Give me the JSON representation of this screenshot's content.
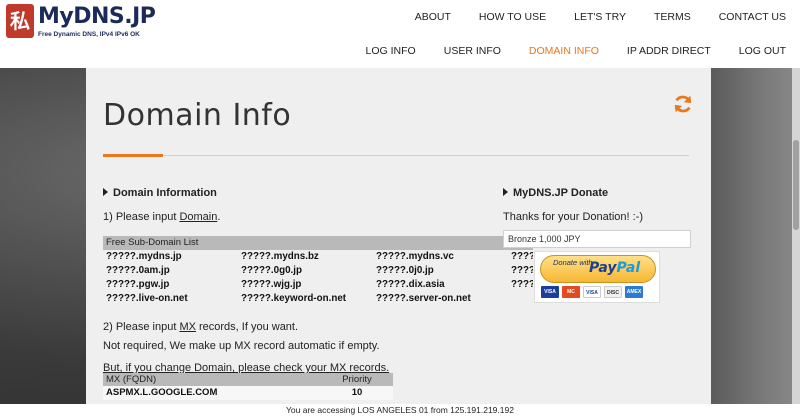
{
  "brand": {
    "logo_glyph": "私",
    "name": "MyDNS.JP",
    "tagline": "Free Dynamic DNS, IPv4 IPv6 OK"
  },
  "nav": {
    "row1": [
      "ABOUT",
      "HOW TO USE",
      "LET'S TRY",
      "TERMS",
      "CONTACT US"
    ],
    "row2": [
      "LOG INFO",
      "USER INFO",
      "DOMAIN INFO",
      "IP ADDR DIRECT",
      "LOG OUT"
    ],
    "active": "DOMAIN INFO",
    "accent_color": "#e8771d"
  },
  "page": {
    "title": "Domain Info",
    "refresh_icon": "refresh-icon"
  },
  "domain_info": {
    "heading": "Domain Information",
    "step1_prefix": "1) Please input ",
    "step1_link": "Domain",
    "step1_suffix": ".",
    "table_title": "Free Sub-Domain List",
    "subdomains": [
      "?????.mydns.jp",
      "?????.mydns.bz",
      "?????.mydns.vc",
      "?????.",
      "?????.0am.jp",
      "?????.0g0.jp",
      "?????.0j0.jp",
      "?????.",
      "?????.pgw.jp",
      "?????.wjg.jp",
      "?????.dix.asia",
      "?????.",
      "?????.live-on.net",
      "?????.keyword-on.net",
      "?????.server-on.net",
      ""
    ],
    "step2_prefix": "2) Please input ",
    "step2_link": "MX",
    "step2_suffix": " records, If you want.",
    "step2_note": "Not required, We make up MX record automatic if empty.",
    "step2_warning": "But, if you change Domain, please check your MX records.",
    "mx_table": {
      "headers": [
        "MX (FQDN)",
        "Priority"
      ],
      "rows": [
        [
          "ASPMX.L.GOOGLE.COM",
          "10"
        ]
      ]
    }
  },
  "donate": {
    "heading": "MyDNS.JP Donate",
    "thanks": "Thanks for your Donation! :-)",
    "selected_option": "Bronze 1,000 JPY",
    "button_small": "Donate with",
    "button_brand_a": "Pay",
    "button_brand_b": "Pal",
    "cards": [
      "VISA",
      "MC",
      "VISA",
      "DISC",
      "AMEX"
    ]
  },
  "footer": {
    "text": "You are accessing LOS ANGELES 01 from 125.191.219.192"
  }
}
